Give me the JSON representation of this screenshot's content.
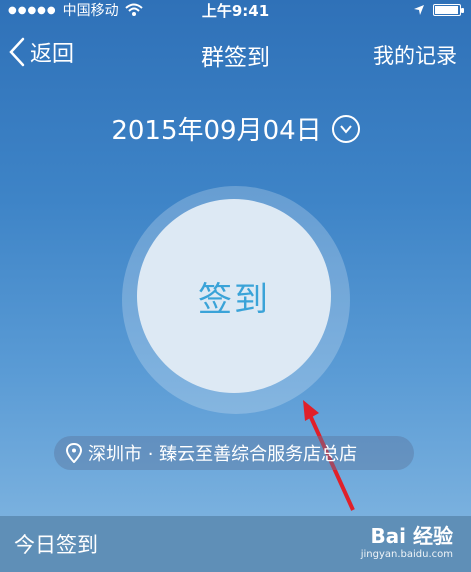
{
  "status": {
    "carrier": "中国移动",
    "time": "上午9:41"
  },
  "nav": {
    "back_label": "返回",
    "title": "群签到",
    "records_label": "我的记录"
  },
  "date": {
    "value": "2015年09月04日"
  },
  "action": {
    "sign_in_label": "签到"
  },
  "location": {
    "text": "深圳市 · 臻云至善综合服务店总店"
  },
  "bottom": {
    "tab_label": "今日签到"
  },
  "watermark": {
    "brand": "Bai 经验",
    "url": "jingyan.baidu.com"
  },
  "colors": {
    "accent": "#3aa3d8",
    "arrow": "#e0202a"
  },
  "battery": {
    "level": 0.9
  }
}
